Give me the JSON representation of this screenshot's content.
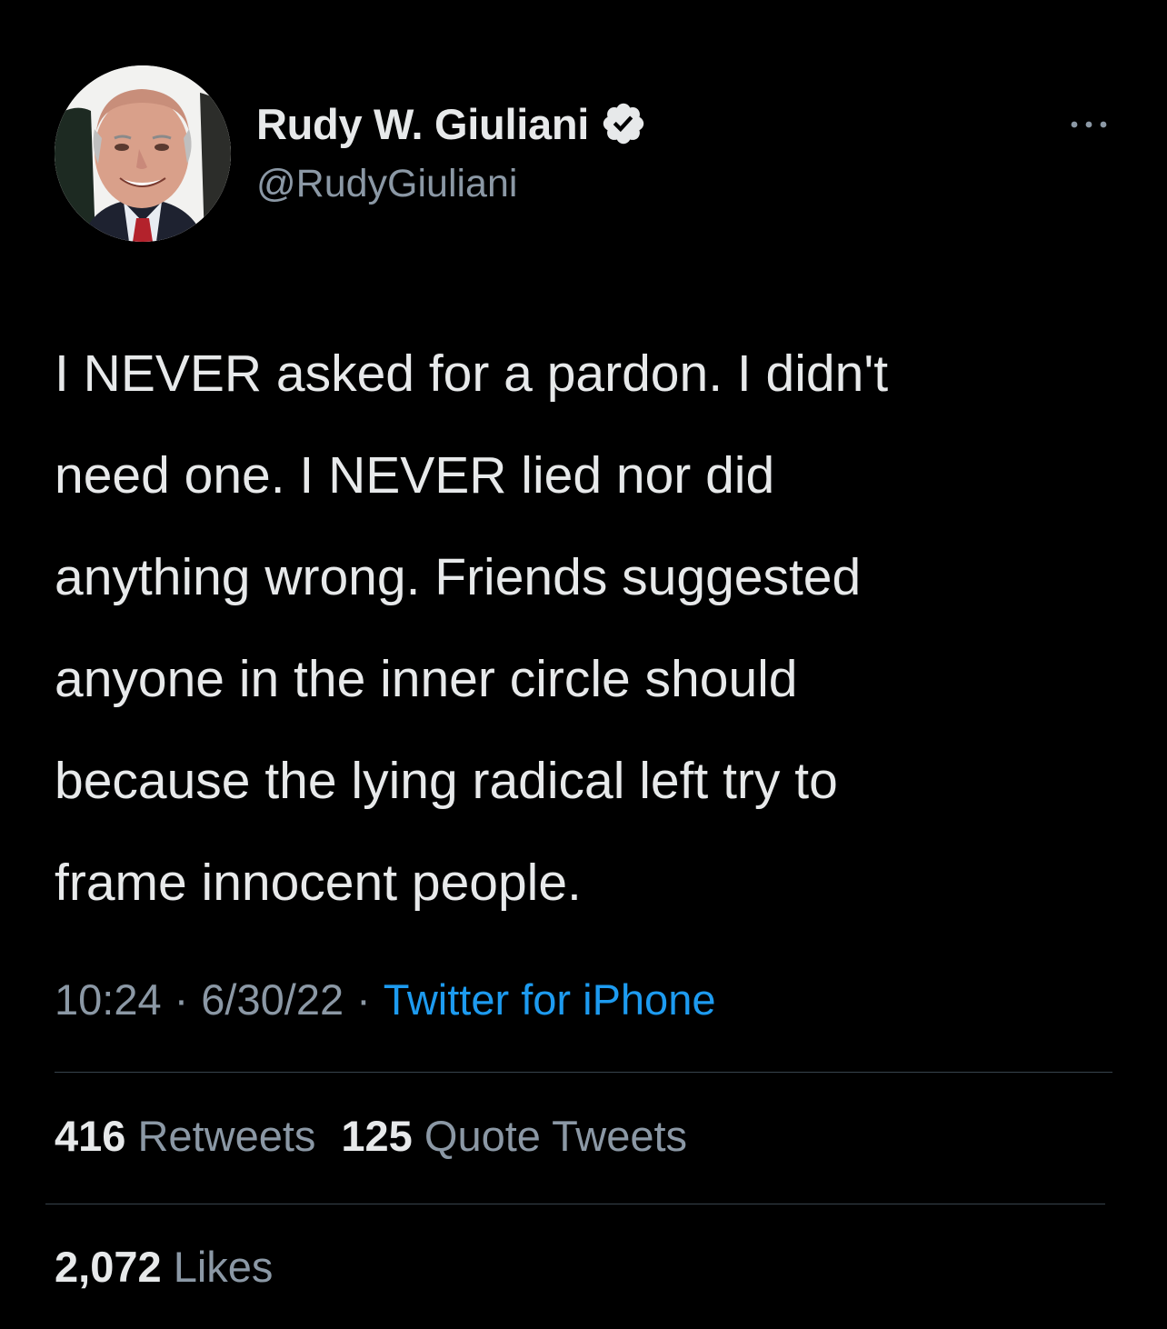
{
  "author": {
    "display_name": "Rudy W. Giuliani",
    "handle": "@RudyGiuliani",
    "verified": true
  },
  "tweet": {
    "lines": [
      "I NEVER asked for a pardon. I didn't",
      "need one. I NEVER lied nor did",
      "anything wrong. Friends suggested",
      "anyone in the inner circle should",
      "because the lying radical left try to",
      "frame innocent people."
    ],
    "time": "10:24",
    "date": "6/30/22",
    "separator": "·",
    "source": "Twitter for iPhone"
  },
  "stats": {
    "retweets_count": "416",
    "retweets_label": "Retweets",
    "quotes_count": "125",
    "quotes_label": "Quote Tweets",
    "likes_count": "2,072",
    "likes_label": "Likes"
  },
  "icons": {
    "verified": "verified-badge-icon",
    "more": "more-options-icon"
  },
  "colors": {
    "background": "#000000",
    "text": "#e7e9ea",
    "secondary": "#8b98a5",
    "link": "#1d9bf0",
    "divider": "#38444d"
  }
}
